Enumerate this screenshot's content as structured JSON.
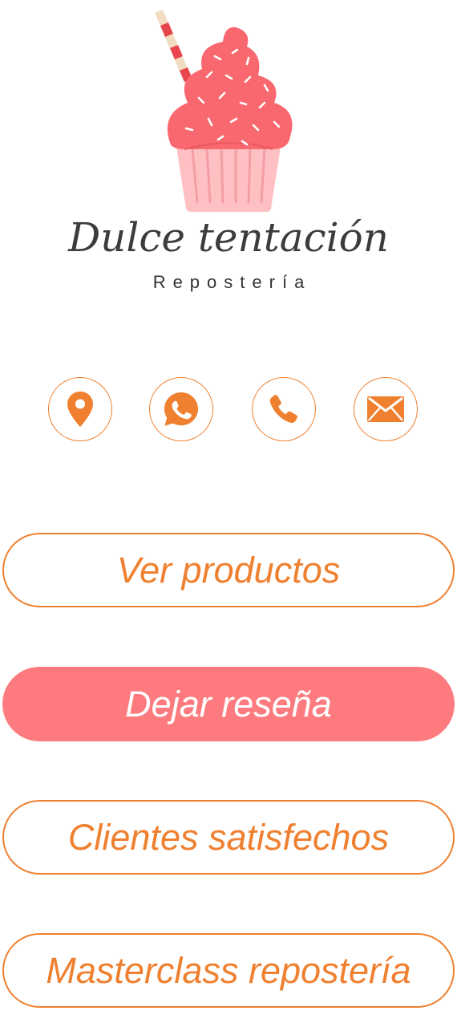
{
  "brand": {
    "title": "Dulce tentación",
    "subtitle": "Repostería"
  },
  "contact_icons": [
    {
      "name": "location-pin-icon"
    },
    {
      "name": "whatsapp-icon"
    },
    {
      "name": "phone-icon"
    },
    {
      "name": "mail-icon"
    }
  ],
  "menu": {
    "products_label": "Ver productos",
    "review_label": "Dejar reseña",
    "clients_label": "Clientes satisfechos",
    "masterclass_label": "Masterclass repostería"
  },
  "colors": {
    "accent_orange": "#ef8030",
    "accent_pink": "#fd7b7e",
    "frosting": "#f9686e",
    "cup": "#ffc0c4",
    "text_dark": "#3c3c3c"
  }
}
